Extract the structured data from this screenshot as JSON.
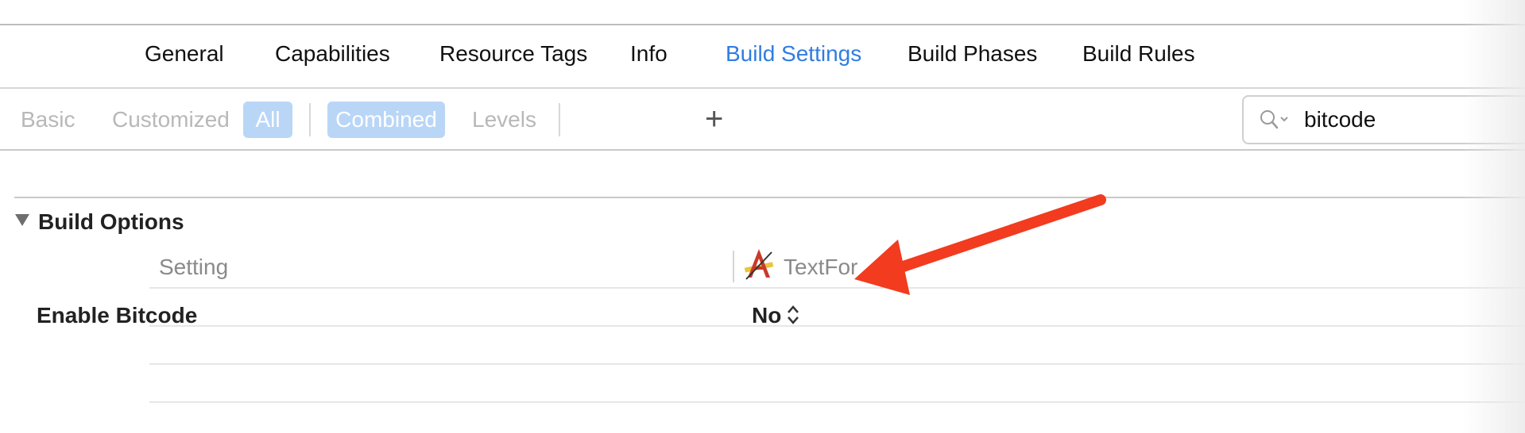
{
  "tabs": [
    {
      "label": "General"
    },
    {
      "label": "Capabilities"
    },
    {
      "label": "Resource Tags"
    },
    {
      "label": "Info"
    },
    {
      "label": "Build Settings",
      "active": true
    },
    {
      "label": "Build Phases"
    },
    {
      "label": "Build Rules"
    }
  ],
  "filters": {
    "basic": "Basic",
    "customized": "Customized",
    "all": "All",
    "combined": "Combined",
    "levels": "Levels",
    "add": "+"
  },
  "search": {
    "value": "bitcode",
    "icon": "search-icon"
  },
  "section": {
    "title": "Build Options",
    "disclosure_icon": "disclosure-triangle-down-icon",
    "columns": {
      "setting": "Setting",
      "target": "TextFor",
      "target_icon": "app-target-icon"
    },
    "rows": [
      {
        "setting": "Enable Bitcode",
        "value": "No",
        "control_icon": "stepper-updown-icon"
      }
    ]
  },
  "colors": {
    "accent": "#2f7de1",
    "pill": "#b9d6f7",
    "annotation_arrow": "#f23b1f"
  }
}
